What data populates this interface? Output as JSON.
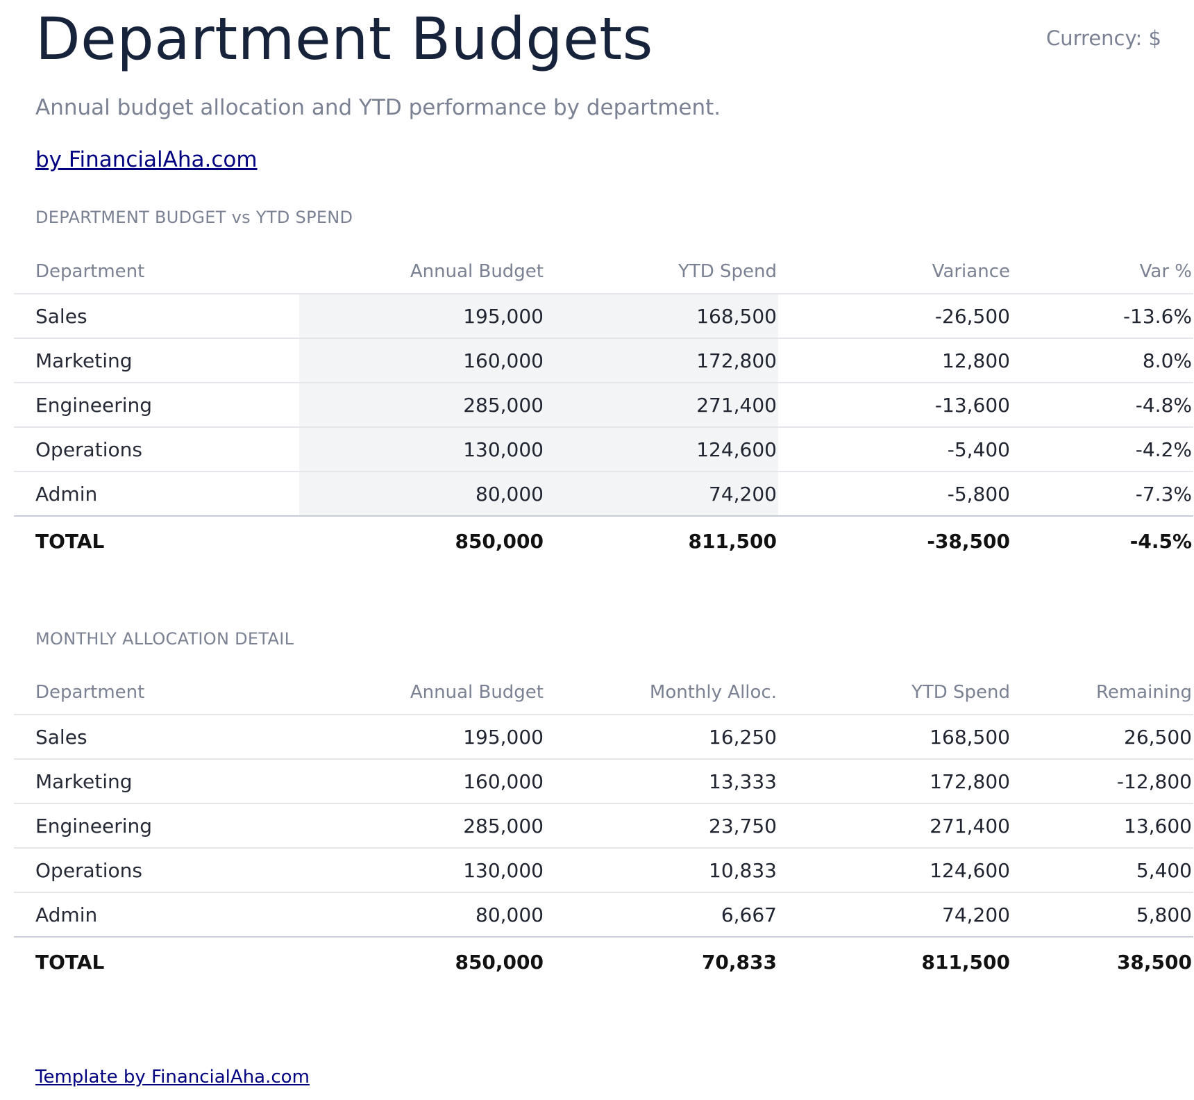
{
  "header": {
    "title": "Department Budgets",
    "currency": "Currency: $",
    "subtitle": "Annual budget allocation and YTD performance by department.",
    "brand_link": "by FinancialAha.com"
  },
  "budget_vs_spend": {
    "label": "DEPARTMENT BUDGET vs YTD SPEND",
    "columns": [
      "Department",
      "Annual Budget",
      "YTD Spend",
      "Variance",
      "Var %"
    ],
    "rows": [
      {
        "department": "Sales",
        "annual_budget": "195,000",
        "ytd_spend": "168,500",
        "variance": "-26,500",
        "var_pct": "-13.6%"
      },
      {
        "department": "Marketing",
        "annual_budget": "160,000",
        "ytd_spend": "172,800",
        "variance": "12,800",
        "var_pct": "8.0%"
      },
      {
        "department": "Engineering",
        "annual_budget": "285,000",
        "ytd_spend": "271,400",
        "variance": "-13,600",
        "var_pct": "-4.8%"
      },
      {
        "department": "Operations",
        "annual_budget": "130,000",
        "ytd_spend": "124,600",
        "variance": "-5,400",
        "var_pct": "-4.2%"
      },
      {
        "department": "Admin",
        "annual_budget": "80,000",
        "ytd_spend": "74,200",
        "variance": "-5,800",
        "var_pct": "-7.3%"
      }
    ],
    "total": {
      "department": "TOTAL",
      "annual_budget": "850,000",
      "ytd_spend": "811,500",
      "variance": "-38,500",
      "var_pct": "-4.5%"
    }
  },
  "monthly_allocation": {
    "label": "MONTHLY ALLOCATION DETAIL",
    "columns": [
      "Department",
      "Annual Budget",
      "Monthly Alloc.",
      "YTD Spend",
      "Remaining"
    ],
    "rows": [
      {
        "department": "Sales",
        "annual_budget": "195,000",
        "monthly_alloc": "16,250",
        "ytd_spend": "168,500",
        "remaining": "26,500"
      },
      {
        "department": "Marketing",
        "annual_budget": "160,000",
        "monthly_alloc": "13,333",
        "ytd_spend": "172,800",
        "remaining": "-12,800"
      },
      {
        "department": "Engineering",
        "annual_budget": "285,000",
        "monthly_alloc": "23,750",
        "ytd_spend": "271,400",
        "remaining": "13,600"
      },
      {
        "department": "Operations",
        "annual_budget": "130,000",
        "monthly_alloc": "10,833",
        "ytd_spend": "124,600",
        "remaining": "5,400"
      },
      {
        "department": "Admin",
        "annual_budget": "80,000",
        "monthly_alloc": "6,667",
        "ytd_spend": "74,200",
        "remaining": "5,800"
      }
    ],
    "total": {
      "department": "TOTAL",
      "annual_budget": "850,000",
      "monthly_alloc": "70,833",
      "ytd_spend": "811,500",
      "remaining": "38,500"
    }
  },
  "colors": {
    "favorable": "#087a4e",
    "unfavorable": "#b81a1a",
    "link": "#000080",
    "muted": "#7a8193",
    "title": "#17223b"
  },
  "footer": {
    "link": "Template by FinancialAha.com"
  }
}
